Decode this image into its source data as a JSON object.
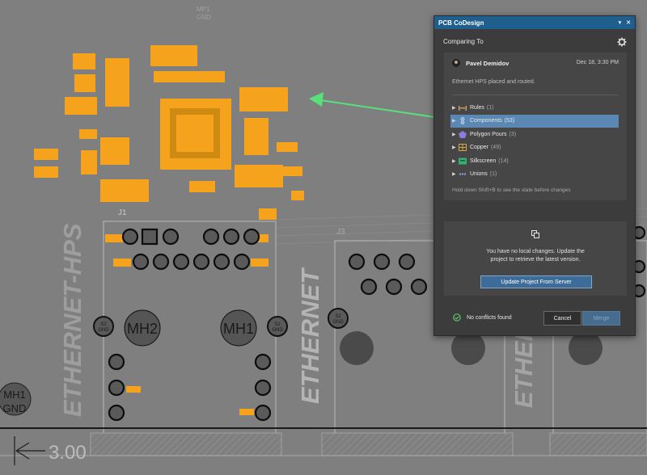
{
  "pcb": {
    "silk_ethernet_hps": "ETHERNET-HPS",
    "silk_ethernet_1": "ETHERNET",
    "silk_ethernet_2": "ETHER",
    "mh2": "MH2",
    "mh1": "MH1",
    "mh1_left": "MH1",
    "gnd_left": "GND",
    "s1": "S1",
    "s2": "S2",
    "gnd": "GND",
    "j1": "J1",
    "j3": "J3",
    "mp1": "MP1",
    "mp1_gnd": "GND",
    "dim": "3.00"
  },
  "panel": {
    "title": "PCB CoDesign",
    "menu_glyph": "▾",
    "close_glyph": "✕",
    "comparing_label": "Comparing To",
    "author": "Pavel Demidov",
    "date": "Dec 18, 3:30 PM",
    "description": "Ethernet HPS placed and routed.",
    "tree": [
      {
        "label": "Rules",
        "count": "(1)",
        "icon": "rules-icon",
        "color": "#c8a060"
      },
      {
        "label": "Components",
        "count": "(53)",
        "icon": "component-icon",
        "color": "#9ab8d8"
      },
      {
        "label": "Polygon Pours",
        "count": "(3)",
        "icon": "polygon-icon",
        "color": "#8a7be0"
      },
      {
        "label": "Copper",
        "count": "(49)",
        "icon": "copper-icon",
        "color": "#d8a640"
      },
      {
        "label": "Silkscreen",
        "count": "(14)",
        "icon": "silkscreen-icon",
        "color": "#34b070"
      },
      {
        "label": "Unions",
        "count": "(1)",
        "icon": "unions-icon",
        "color": "#7aa0e0"
      }
    ],
    "hint": "Hold down Shift+B to see the state before changes",
    "local_message_1": "You have no local changes. Update the",
    "local_message_2": "project to retrieve the latest version.",
    "update_button": "Update Project From Server",
    "conflicts": "No conflicts found",
    "cancel": "Cancel",
    "merge": "Merge"
  },
  "colors": {
    "pad": "#f5a21c",
    "board": "#7f7f7f",
    "arrow": "#58e07a",
    "selected": "#5b87b3"
  }
}
